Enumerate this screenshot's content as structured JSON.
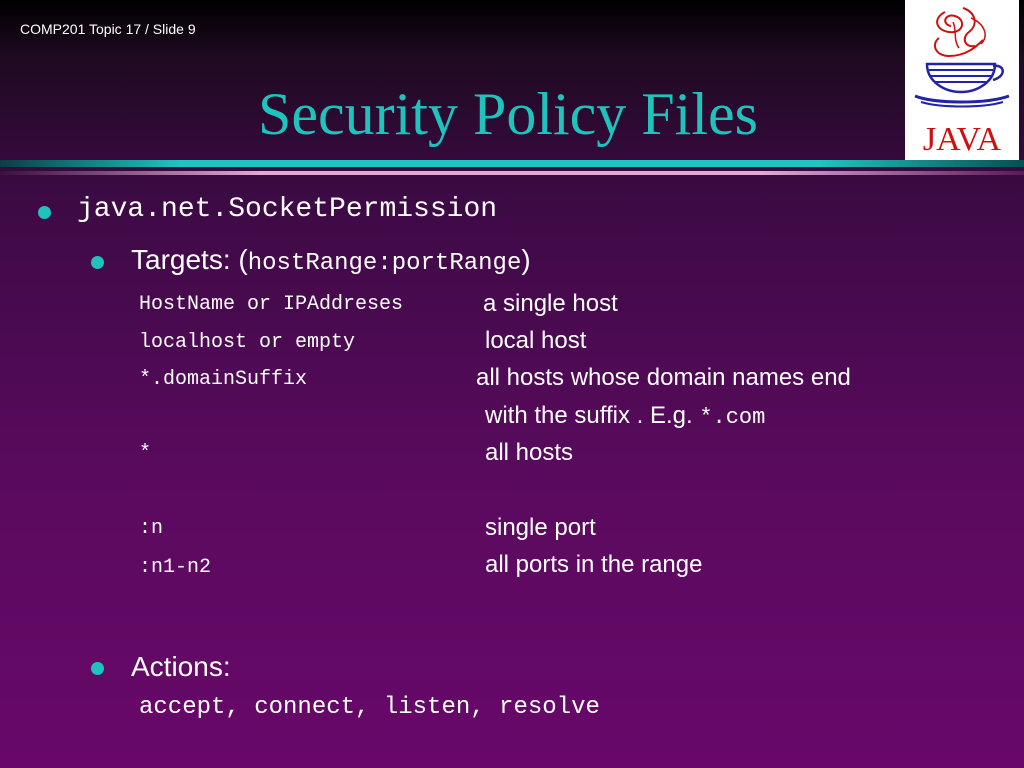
{
  "header": {
    "label": "COMP201 Topic 17 / Slide 9"
  },
  "slide": {
    "title": "Security Policy Files",
    "bullet1": "java.net.SocketPermission",
    "targets": {
      "prefix": "Targets: (",
      "code": "hostRange:portRange",
      "suffix": ")"
    },
    "rows": [
      {
        "code": "HostName or IPAddreses",
        "desc": "a single host"
      },
      {
        "code": "localhost or empty",
        "desc": "local host"
      },
      {
        "code": "*.domainSuffix",
        "desc": "all hosts whose domain names end"
      },
      {
        "code": "",
        "desc_prefix": "with the suffix . E.g. ",
        "desc_code": "*.com"
      },
      {
        "code": "*",
        "desc": "all hosts"
      },
      {
        "code": ":n",
        "desc": "single port"
      },
      {
        "code": ":n1-n2",
        "desc": "all ports in the range"
      }
    ],
    "actions": {
      "label": "Actions:",
      "code": "accept, connect, listen, resolve"
    }
  },
  "logo": {
    "text": "JAVA",
    "color": "#cc1111"
  },
  "colors": {
    "accent": "#1ec3bd",
    "background": "#5a0a5e"
  }
}
